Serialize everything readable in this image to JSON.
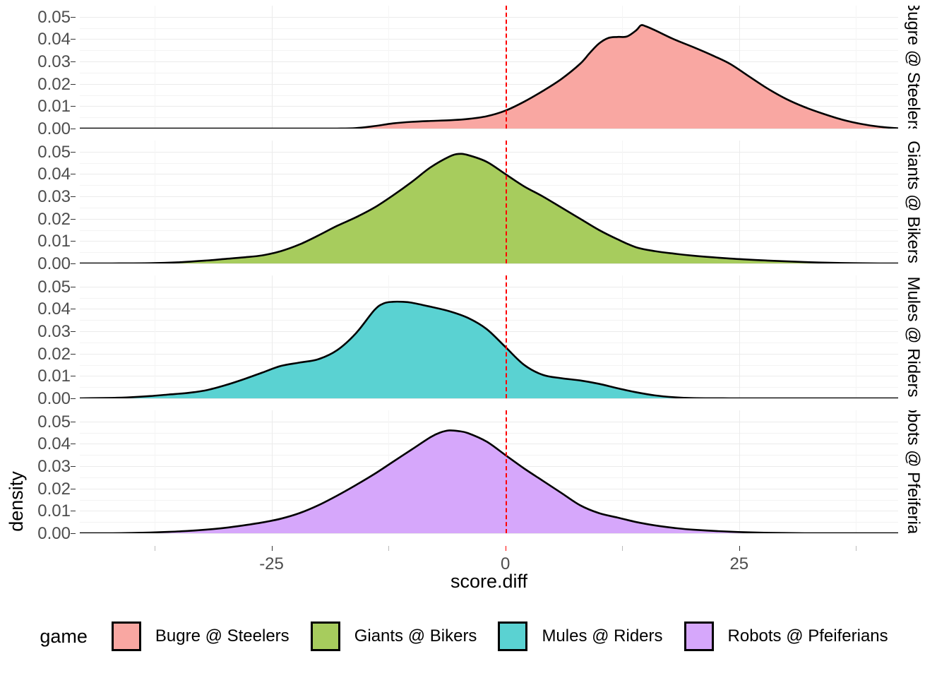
{
  "axes": {
    "y_title": "density",
    "x_title": "score.diff",
    "y_ticks": [
      "0.00",
      "0.01",
      "0.02",
      "0.03",
      "0.04",
      "0.05"
    ],
    "x_ticks": [
      "-25",
      "0",
      "25"
    ],
    "x_tick_values": [
      -25,
      0,
      25
    ],
    "y_range": [
      0.0,
      0.055
    ],
    "x_range": [
      -45.5,
      42.0
    ]
  },
  "legend": {
    "title": "game",
    "items": [
      {
        "label": "Bugre @ Steelers",
        "color": "#f9a7a2"
      },
      {
        "label": "Giants @ Bikers",
        "color": "#a7cc5d"
      },
      {
        "label": "Mules @ Riders",
        "color": "#5ad2d2"
      },
      {
        "label": "Robots @ Pfeiferians",
        "color": "#d6a7fb"
      }
    ]
  },
  "strips": [
    {
      "label": "Bugre @ Steelers"
    },
    {
      "label": "Giants @ Bikers"
    },
    {
      "label": "Mules @ Riders"
    },
    {
      "label": "Robots @ Pfeiferians"
    }
  ],
  "reference_line": {
    "value": 0,
    "color": "#ff0000",
    "style": "dashed"
  },
  "chart_data": {
    "type": "area",
    "title": "",
    "xlabel": "score.diff",
    "ylabel": "density",
    "xlim": [
      -45.5,
      42.0
    ],
    "ylim": [
      0.0,
      0.055
    ],
    "grid": true,
    "legend_position": "bottom",
    "facet_variable": "game",
    "reference_line_x": 0,
    "series": [
      {
        "name": "Bugre @ Steelers",
        "color": "#f9a7a2",
        "peak_x": 14.5,
        "peak_y": 0.0462,
        "x": [
          -45.5,
          -40,
          -35,
          -30,
          -25,
          -22,
          -20,
          -18,
          -16,
          -14,
          -12,
          -10,
          -8,
          -6,
          -4,
          -2,
          0,
          2,
          4,
          6,
          8,
          9,
          10,
          11,
          12,
          13,
          14,
          14.5,
          15,
          16,
          18,
          20,
          22,
          24,
          26,
          28,
          30,
          32,
          34,
          36,
          38,
          40,
          42
        ],
        "values": [
          0.0,
          0.0,
          0.0,
          0.0,
          0.0,
          0.0,
          0.0,
          0.0,
          0.0002,
          0.0011,
          0.0023,
          0.003,
          0.0034,
          0.0037,
          0.0043,
          0.0055,
          0.008,
          0.012,
          0.0168,
          0.0222,
          0.029,
          0.0337,
          0.038,
          0.0405,
          0.041,
          0.0412,
          0.044,
          0.0462,
          0.0458,
          0.044,
          0.04,
          0.0366,
          0.033,
          0.029,
          0.0235,
          0.018,
          0.0133,
          0.0096,
          0.0066,
          0.004,
          0.0021,
          0.0008,
          0.0001
        ]
      },
      {
        "name": "Giants @ Bikers",
        "color": "#a7cc5d",
        "peak_x": -5.0,
        "peak_y": 0.049,
        "x": [
          -45.5,
          -42,
          -38,
          -35,
          -32,
          -30,
          -28,
          -26,
          -24,
          -22,
          -20,
          -18,
          -16,
          -14,
          -12,
          -10,
          -8,
          -6,
          -5,
          -4,
          -2,
          0,
          2,
          4,
          6,
          8,
          10,
          12,
          14,
          16,
          18,
          20,
          24,
          28,
          32,
          36,
          40,
          42
        ],
        "values": [
          0.0,
          0.0,
          0.0001,
          0.0005,
          0.0013,
          0.002,
          0.0027,
          0.0036,
          0.0055,
          0.0085,
          0.0125,
          0.0168,
          0.0206,
          0.025,
          0.0305,
          0.0365,
          0.043,
          0.0478,
          0.049,
          0.0485,
          0.0455,
          0.04,
          0.0345,
          0.03,
          0.025,
          0.02,
          0.015,
          0.0108,
          0.0072,
          0.0055,
          0.0044,
          0.0035,
          0.0022,
          0.0013,
          0.0006,
          0.0002,
          0.0,
          0.0
        ]
      },
      {
        "name": "Mules @ Riders",
        "color": "#5ad2d2",
        "peak_x": -12.5,
        "peak_y": 0.0432,
        "x": [
          -45.5,
          -42,
          -40,
          -38,
          -36,
          -34,
          -32,
          -30,
          -28,
          -26,
          -24,
          -22,
          -20,
          -18,
          -16,
          -14,
          -13,
          -12,
          -11,
          -10,
          -8,
          -6,
          -4,
          -2,
          0,
          2,
          4,
          6,
          8,
          10,
          12,
          14,
          16,
          18,
          20,
          24,
          28,
          32,
          36,
          40,
          42
        ],
        "values": [
          0.0,
          0.0002,
          0.0005,
          0.001,
          0.0017,
          0.0024,
          0.0036,
          0.0058,
          0.0085,
          0.0115,
          0.0145,
          0.016,
          0.0175,
          0.0215,
          0.029,
          0.0395,
          0.0425,
          0.0432,
          0.0432,
          0.0428,
          0.041,
          0.039,
          0.036,
          0.031,
          0.023,
          0.015,
          0.0105,
          0.009,
          0.008,
          0.0065,
          0.0045,
          0.0027,
          0.0013,
          0.0005,
          0.0001,
          0.0,
          0.0,
          0.0,
          0.0,
          0.0,
          0.0
        ]
      },
      {
        "name": "Robots @ Pfeiferians",
        "color": "#d6a7fb",
        "peak_x": -6.0,
        "peak_y": 0.046,
        "x": [
          -45.5,
          -42,
          -40,
          -38,
          -36,
          -34,
          -32,
          -30,
          -28,
          -26,
          -24,
          -22,
          -20,
          -18,
          -16,
          -14,
          -12,
          -10,
          -8,
          -7,
          -6,
          -5,
          -4,
          -2,
          0,
          2,
          4,
          6,
          8,
          10,
          12,
          14,
          16,
          18,
          20,
          24,
          28,
          32,
          36,
          40,
          42
        ],
        "values": [
          0.0,
          0.0,
          0.0001,
          0.0003,
          0.0006,
          0.001,
          0.0016,
          0.0024,
          0.0035,
          0.0048,
          0.0065,
          0.009,
          0.0125,
          0.0168,
          0.0215,
          0.0265,
          0.032,
          0.0375,
          0.043,
          0.045,
          0.046,
          0.0457,
          0.0448,
          0.041,
          0.035,
          0.029,
          0.0235,
          0.018,
          0.0125,
          0.009,
          0.007,
          0.005,
          0.0035,
          0.0024,
          0.0016,
          0.0007,
          0.0002,
          0.0,
          0.0,
          0.0,
          0.0
        ]
      }
    ]
  }
}
